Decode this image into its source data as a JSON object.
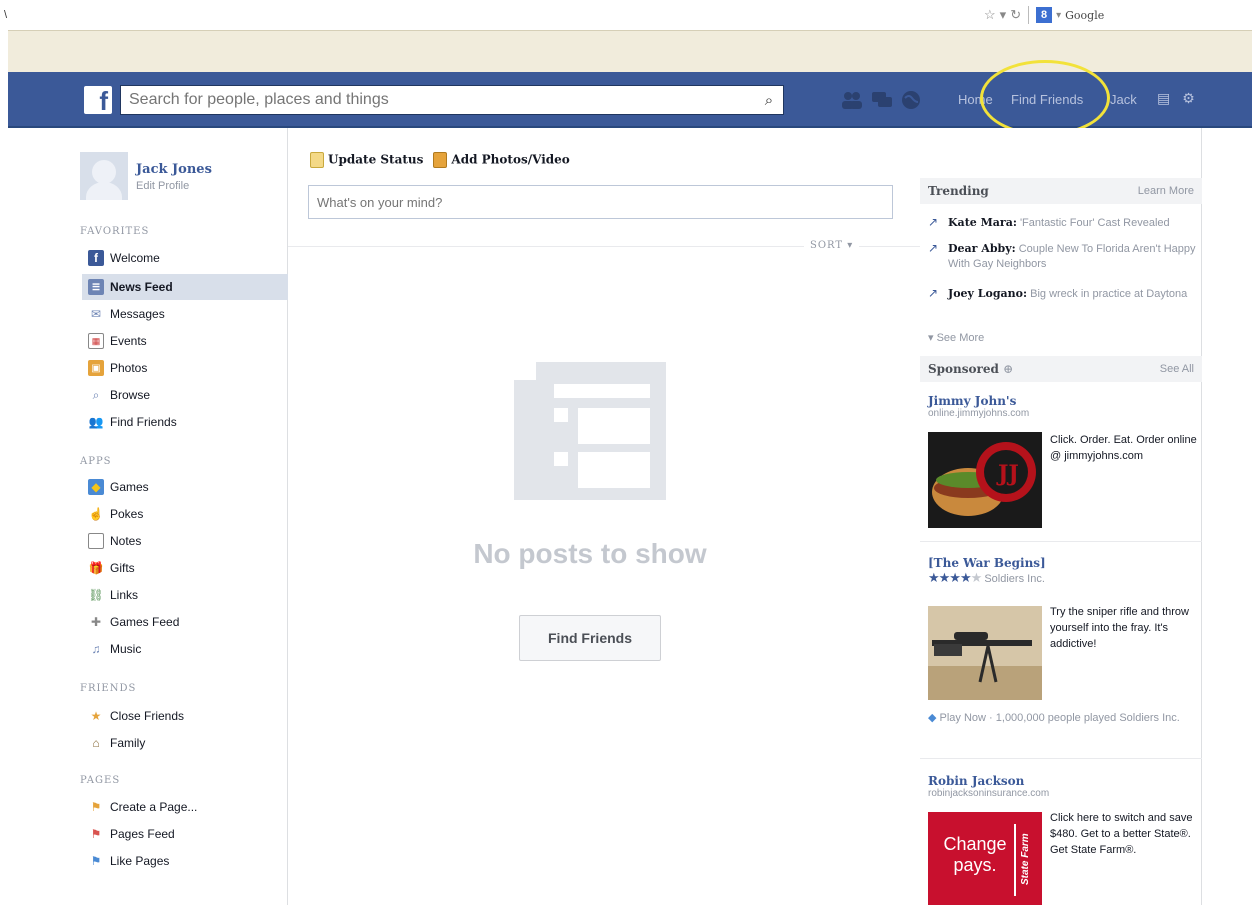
{
  "browser": {
    "left_char": "\\",
    "search_engine": "Google"
  },
  "topbar": {
    "logo": "f",
    "search_placeholder": "Search for people, places and things",
    "home": "Home",
    "find_friends": "Find Friends",
    "jack": "Jack"
  },
  "profile": {
    "name": "Jack Jones",
    "edit": "Edit Profile"
  },
  "sidebar": {
    "favorites_header": "FAVORITES",
    "favorites": [
      {
        "label": "Welcome",
        "icon": "facebook-icon"
      },
      {
        "label": "News Feed",
        "icon": "news-feed-icon"
      },
      {
        "label": "Messages",
        "icon": "messages-icon"
      },
      {
        "label": "Events",
        "icon": "events-icon"
      },
      {
        "label": "Photos",
        "icon": "photos-icon"
      },
      {
        "label": "Browse",
        "icon": "search-icon"
      },
      {
        "label": "Find Friends",
        "icon": "friends-icon"
      }
    ],
    "apps_header": "APPS",
    "apps": [
      {
        "label": "Games",
        "icon": "games-icon"
      },
      {
        "label": "Pokes",
        "icon": "pokes-icon"
      },
      {
        "label": "Notes",
        "icon": "notes-icon"
      },
      {
        "label": "Gifts",
        "icon": "gifts-icon"
      },
      {
        "label": "Links",
        "icon": "links-icon"
      },
      {
        "label": "Games Feed",
        "icon": "games-feed-icon"
      },
      {
        "label": "Music",
        "icon": "music-icon"
      }
    ],
    "friends_header": "FRIENDS",
    "friends": [
      {
        "label": "Close Friends",
        "icon": "star-icon"
      },
      {
        "label": "Family",
        "icon": "house-icon"
      }
    ],
    "pages_header": "PAGES",
    "pages": [
      {
        "label": "Create a Page...",
        "icon": "create-page-icon"
      },
      {
        "label": "Pages Feed",
        "icon": "pages-feed-icon"
      },
      {
        "label": "Like Pages",
        "icon": "like-pages-icon"
      }
    ]
  },
  "composer": {
    "update_status": "Update Status",
    "add_photos": "Add Photos/Video",
    "placeholder": "What's on your mind?",
    "sort": "SORT"
  },
  "feed": {
    "empty_text": "No posts to show",
    "find_friends_button": "Find Friends"
  },
  "trending": {
    "title": "Trending",
    "learn_more": "Learn More",
    "items": [
      {
        "name": "Kate Mara:",
        "text": "'Fantastic Four' Cast Revealed"
      },
      {
        "name": "Dear Abby:",
        "text": "Couple New To Florida Aren't Happy With Gay Neighbors"
      },
      {
        "name": "Joey Logano:",
        "text": "Big wreck in practice at Daytona"
      }
    ],
    "see_more": "See More"
  },
  "sponsored": {
    "title": "Sponsored",
    "see_all": "See All",
    "ads": [
      {
        "title": "Jimmy John's",
        "url": "online.jimmyjohns.com",
        "text": "Click. Order. Eat. Order online @ jimmyjohns.com"
      },
      {
        "title": "[The War Begins]",
        "meta": "Soldiers Inc.",
        "text": "Try the sniper rifle and throw yourself into the fray. It's addictive!",
        "footer": "Play Now · 1,000,000 people played Soldiers Inc.",
        "rating": 3.5
      },
      {
        "title": "Robin Jackson",
        "url": "robinjacksoninsurance.com",
        "text": "Click here to switch and save $480. Get to a better State®. Get State Farm®.",
        "image_text": "Change pays.",
        "brand": "State Farm"
      }
    ]
  },
  "colors": {
    "brand_blue": "#3b5998",
    "highlight": "#f2e23a"
  }
}
